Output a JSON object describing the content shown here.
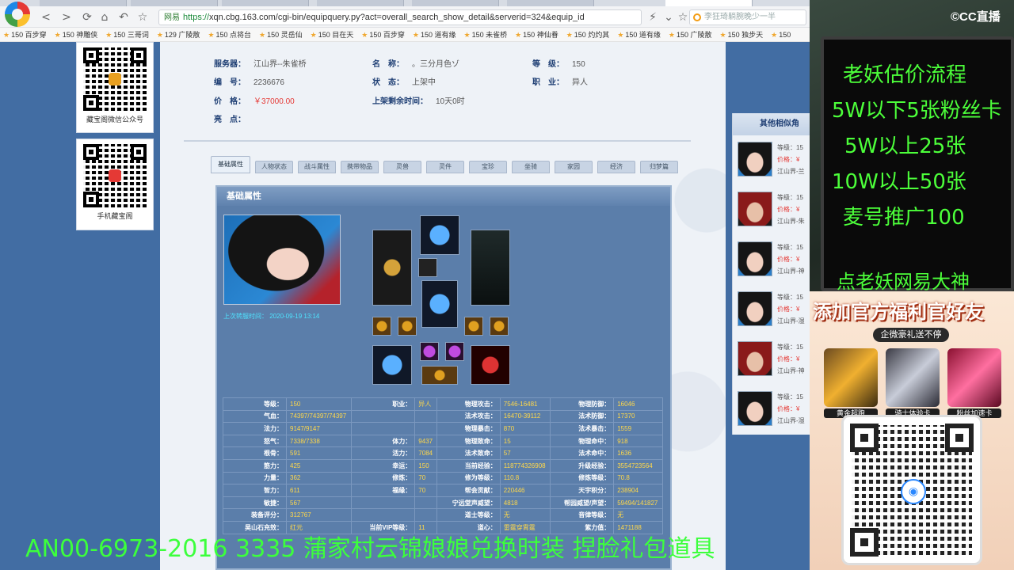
{
  "browser": {
    "url_site": "网易",
    "url_https": "https://",
    "url_rest": "xqn.cbg.163.com/cgi-bin/equipquery.py?act=overall_search_show_detail&serverid=324&equip_id",
    "search_text": "李狂琦躺腕晚少一半",
    "bookmarks": [
      "150 百步穿",
      "150 神雕侠",
      "150 三哥词",
      "129 广陵散",
      "150 点将台",
      "150 灵岳仙",
      "150 目在天",
      "150 百步穿",
      "150 道有缘",
      "150 未雀桥",
      "150 神仙眷",
      "150 灼灼其",
      "150 道有缘",
      "150 广陵散",
      "150 独步天",
      "150"
    ]
  },
  "left_panel": {
    "wechat_label": "藏宝阁微信公众号",
    "mobile_label": "手机藏宝阁"
  },
  "detail": {
    "server_label": "服务器：",
    "server": "江山界--朱雀桥",
    "name_label": "名　称：",
    "name": "。三分月色ゾ",
    "level_label": "等　级：",
    "level": "150",
    "id_label": "编　号：",
    "id": "2236676",
    "status_label": "状　态：",
    "status": "上架中",
    "job_label": "职　业：",
    "job": "异人",
    "price_label": "价　格：",
    "price": "￥37000.00",
    "time_label": "上架剩余时间：",
    "time": "10天0时",
    "highlight_label": "亮　点："
  },
  "tabs": [
    "基础属性",
    "人物状态",
    "战斗属性",
    "携带物品",
    "灵兽",
    "灵件",
    "宝珍",
    "坐骑",
    "家园",
    "经济",
    "归梦篇"
  ],
  "attr": {
    "header": "基础属性",
    "caption": "上次转服时间： 2020-09-19 13:14",
    "rows": [
      [
        "等级：",
        "150",
        "职业：",
        "异人",
        "物理攻击：",
        "7546-16481",
        "物理防御：",
        "16046"
      ],
      [
        "气血：",
        "74397/74397/74397",
        "",
        "",
        "法术攻击：",
        "16470-39112",
        "法术防御：",
        "17370"
      ],
      [
        "法力：",
        "9147/9147",
        "",
        "",
        "物理暴击：",
        "870",
        "法术暴击：",
        "1559"
      ],
      [
        "怒气：",
        "7338/7338",
        "体力：",
        "9437",
        "物理致命：",
        "15",
        "物理命中：",
        "918"
      ],
      [
        "根骨：",
        "591",
        "活力：",
        "7084",
        "法术致命：",
        "57",
        "法术命中：",
        "1636"
      ],
      [
        "筋力：",
        "425",
        "幸运：",
        "150",
        "当前经验：",
        "118774326908",
        "升级经验：",
        "3554723564"
      ],
      [
        "力量：",
        "362",
        "修炼：",
        "70",
        "修为等级：",
        "110.8",
        "修炼等级：",
        "70.8"
      ],
      [
        "智力：",
        "611",
        "福缘：",
        "70",
        "帮会贡献：",
        "220446",
        "天宇积分：",
        "238904"
      ],
      [
        "敏捷：",
        "567",
        "",
        "",
        "宁远堂声威望：",
        "4818",
        "帮园威望/声望：",
        "59494/141827"
      ],
      [
        "装备评分：",
        "312767",
        "",
        "",
        "道士等级：",
        "无",
        "音律等级：",
        "无"
      ],
      [
        "吴山石充效：",
        "红元",
        "当前VIP等级：",
        "11",
        "道心：",
        "雷霆穿霄霆",
        "紫力值：",
        "1471188"
      ]
    ]
  },
  "similar": {
    "title": "其他相似角",
    "items": [
      {
        "level": "等级：15",
        "price": "价格：¥",
        "server": "江山界-兰"
      },
      {
        "level": "等级：15",
        "price": "价格：¥",
        "server": "江山界-朱"
      },
      {
        "level": "等级：15",
        "price": "价格：¥",
        "server": "江山界-神"
      },
      {
        "level": "等级：15",
        "price": "价格：¥",
        "server": "江山界-湿"
      },
      {
        "level": "等级：15",
        "price": "价格：¥",
        "server": "江山界-神"
      },
      {
        "level": "等级：15",
        "price": "价格：¥",
        "server": "江山界-湿"
      }
    ]
  },
  "stream": {
    "logo": "©CC直播",
    "board": [
      "老妖估价流程",
      "5W以下5张粉丝卡",
      "5W以上25张",
      "10W以上50张",
      "麦号推广100"
    ],
    "board_tail": "点老妖网易大神",
    "promo_title": "添加官方福利官好友",
    "promo_sub": "企微豪礼送不停",
    "gifts": [
      "黄金超跑",
      "骑士体验卡",
      "粉丝加速卡"
    ]
  },
  "ticker": "AN00-6973-2016 3335 蒲家村云锦娘娘兑换时装 捏脸礼包道具"
}
